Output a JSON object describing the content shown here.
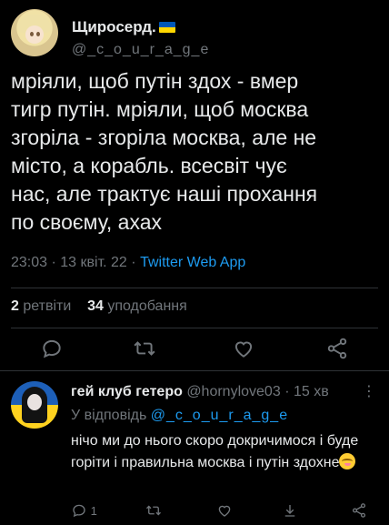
{
  "tweet": {
    "display_name": "Щиросерд.",
    "handle": "@_c_o_u_r_a_g_e",
    "text": "мріяли, щоб путін здох - вмер\nтигр путін. мріяли, щоб москва\nзгоріла - згоріла москва, але не\nмісто, а корабль. всесвіт чує\nнас, але трактує наші прохання\nпо своєму, ахах",
    "time": "23:03",
    "date": "13 квіт. 22",
    "source": "Twitter Web App",
    "retweets_count": "2",
    "retweets_label": "ретвіти",
    "likes_count": "34",
    "likes_label": "уподобання",
    "flag_colors": [
      "#0057b7",
      "#ffd700"
    ]
  },
  "reply": {
    "display_name": "гей клуб гетеро",
    "handle": "@hornylove03",
    "age": "15 хв",
    "replying_prefix": "У відповідь",
    "replying_to": "@_c_o_u_r_a_g_e",
    "text": "нічо ми до нього скоро докричимося і буде горіти і правильна москва і путін здохне",
    "reply_count": "1"
  },
  "colors": {
    "background": "#000000",
    "text": "#e7e9ea",
    "muted": "#71767b",
    "accent": "#1d9bf0",
    "divider": "#2f3336"
  },
  "icons": [
    "reply-icon",
    "retweet-icon",
    "like-icon",
    "share-icon",
    "more-icon",
    "download-icon",
    "smiling-emoji"
  ]
}
